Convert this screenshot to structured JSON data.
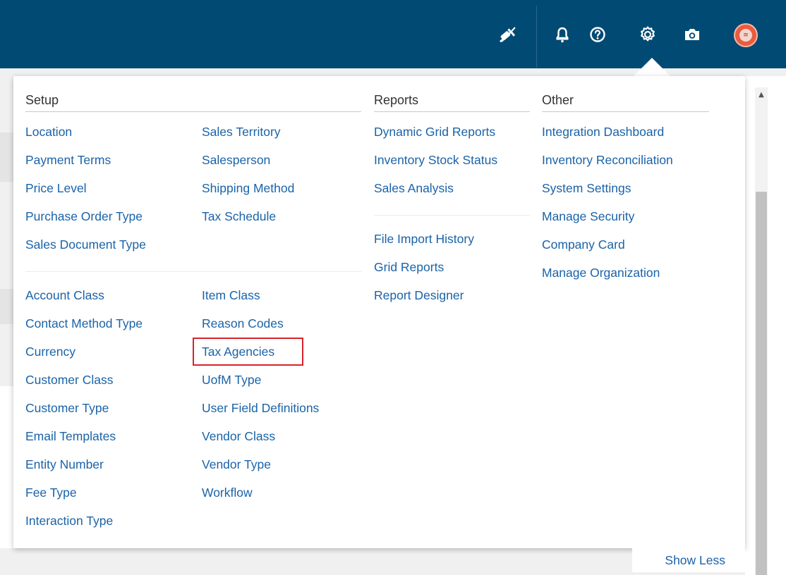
{
  "toolbar": {
    "icons": [
      "plug-disconnected-icon",
      "bell-icon",
      "help-icon",
      "gear-icon",
      "camera-icon",
      "user-avatar"
    ],
    "avatar_glyph": "≡",
    "colors": {
      "bar": "#004a74",
      "icon": "#ffffff"
    }
  },
  "menu": {
    "link_color": "#1a63a8",
    "highlighted_item": "Tax Agencies",
    "setup": {
      "title": "Setup",
      "col1_group1": [
        "Location",
        "Payment Terms",
        "Price Level",
        "Purchase Order Type",
        "Sales Document Type"
      ],
      "col2_group1": [
        "Sales Territory",
        "Salesperson",
        "Shipping Method",
        "Tax Schedule"
      ],
      "col1_group2": [
        "Account Class",
        "Contact Method Type",
        "Currency",
        "Customer Class",
        "Customer Type",
        "Email Templates",
        "Entity Number",
        "Fee Type",
        "Interaction Type"
      ],
      "col2_group2": [
        "Item Class",
        "Reason Codes",
        "Tax Agencies",
        "UofM Type",
        "User Field Definitions",
        "Vendor Class",
        "Vendor Type",
        "Workflow"
      ]
    },
    "reports": {
      "title": "Reports",
      "group1": [
        "Dynamic Grid Reports",
        "Inventory Stock Status",
        "Sales Analysis"
      ],
      "group2": [
        "File Import History",
        "Grid Reports",
        "Report Designer"
      ]
    },
    "other": {
      "title": "Other",
      "items": [
        "Integration Dashboard",
        "Inventory Reconciliation",
        "System Settings",
        "Manage Security",
        "Company Card",
        "Manage Organization"
      ]
    },
    "show_less": "Show Less"
  }
}
